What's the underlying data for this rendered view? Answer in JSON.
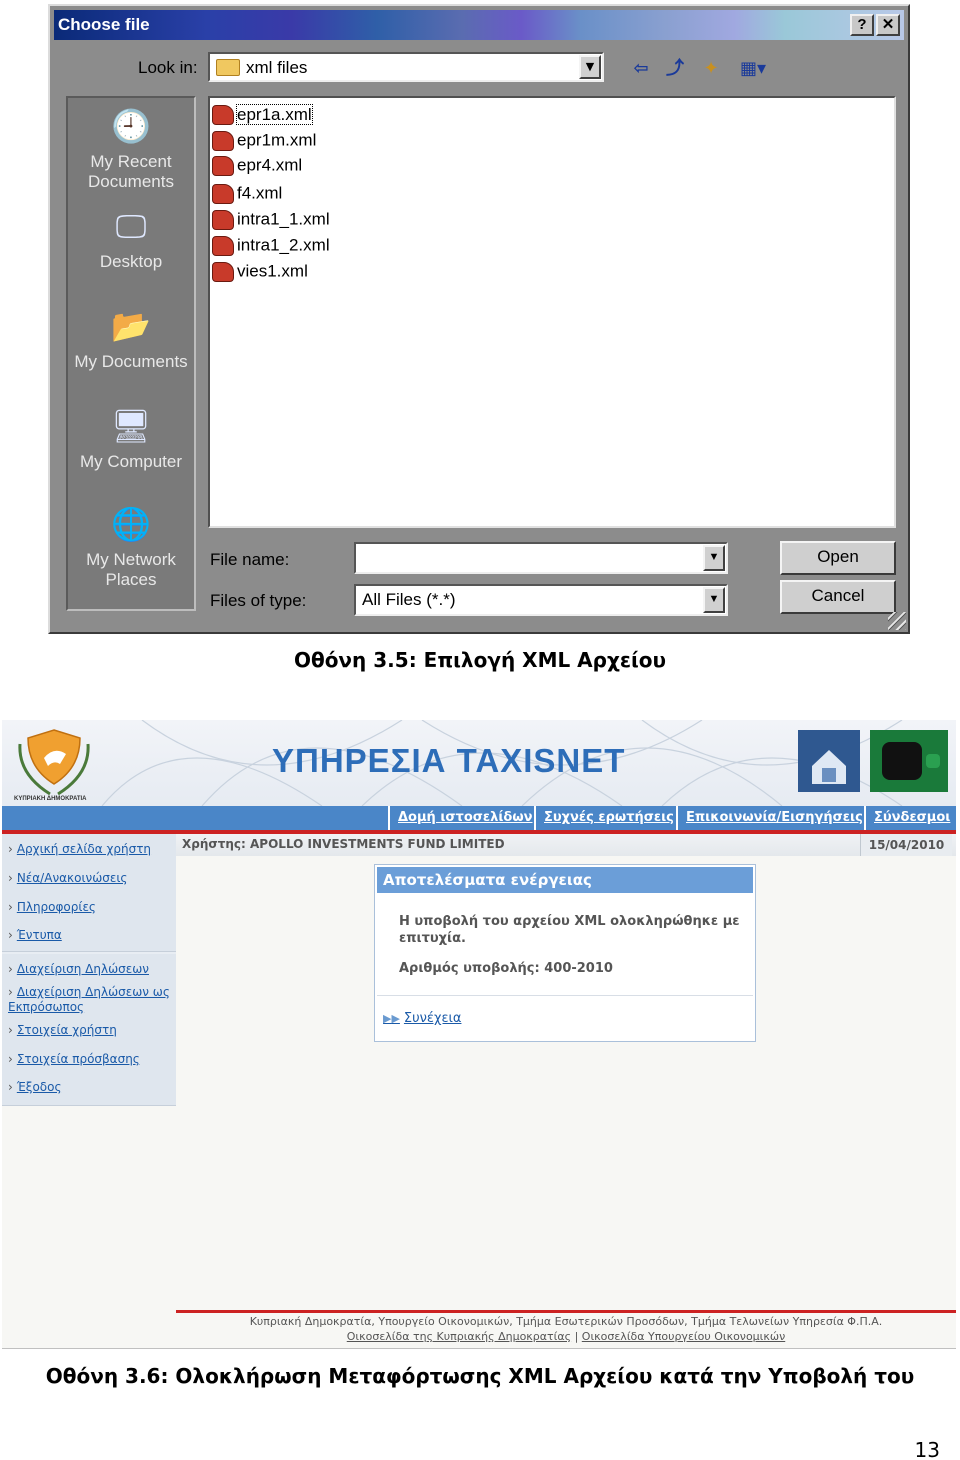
{
  "dialog": {
    "title": "Choose file",
    "help_button": "?",
    "close_button": "✕",
    "look_in_label": "Look in:",
    "look_in_value": "xml files",
    "places": [
      "My Recent Documents",
      "Desktop",
      "My Documents",
      "My Computer",
      "My Network Places"
    ],
    "files": [
      "epr1a.xml",
      "epr1m.xml",
      "epr4.xml",
      "f4.xml",
      "intra1_1.xml",
      "intra1_2.xml",
      "vies1.xml"
    ],
    "file_name_label": "File name:",
    "file_name_value": "",
    "files_of_type_label": "Files of type:",
    "files_of_type_value": "All Files (*.*)",
    "open_button": "Open",
    "cancel_button": "Cancel"
  },
  "caption1": "Οθόνη 3.5: Επιλογή XML Αρχείου",
  "taxisnet": {
    "crest_label": "ΚΥΠΡΙΑΚΗ ΔΗΜΟΚΡΑΤΙΑ",
    "service_title": "ΥΠΗΡΕΣΙΑ TAXISNET",
    "nav": [
      "Δομή ιστοσελίδων",
      "Συχνές ερωτήσεις",
      "Επικοινωνία/Εισηγήσεις",
      "Σύνδεσμοι"
    ],
    "sidebar_group1": [
      "Αρχική σελίδα χρήστη",
      "Νέα/Ανακοινώσεις",
      "Πληροφορίες",
      "Έντυπα"
    ],
    "sidebar_group2": [
      "Διαχείριση Δηλώσεων",
      "Διαχείριση Δηλώσεων ως Εκπρόσωπος",
      "Στοιχεία χρήστη",
      "Στοιχεία πρόσβασης",
      "Έξοδος"
    ],
    "user_label": "Χρήστης: APOLLO INVESTMENTS FUND LIMITED",
    "date": "15/04/2010",
    "result_title": "Αποτελέσματα ενέργειας",
    "result_message": "Η υποβολή του αρχείου XML ολοκληρώθηκε με επιτυχία.",
    "result_number": "Αριθμός υποβολής: 400-2010",
    "continue_link": "Συνέχεια",
    "footer_line1": "Κυπριακή Δημοκρατία, Υπουργείο Οικονομικών, Τμήμα Εσωτερικών Προσόδων, Τμήμα Τελωνείων Υπηρεσία Φ.Π.Α.",
    "footer_link1": "Οικοσελίδα της Κυπριακής Δημοκρατίας",
    "footer_sep": "|",
    "footer_link2": "Οικοσελίδα Υπουργείου Οικονομικών"
  },
  "caption2": "Οθόνη 3.6: Ολοκλήρωση Μεταφόρτωσης XML Αρχείου κατά την Υποβολή του",
  "page_number": "13",
  "colors": {
    "title_bar": "#0a2a78",
    "nav_blue": "#4a86c8",
    "accent_red": "#cc2222",
    "result_header": "#6b9ed8"
  }
}
